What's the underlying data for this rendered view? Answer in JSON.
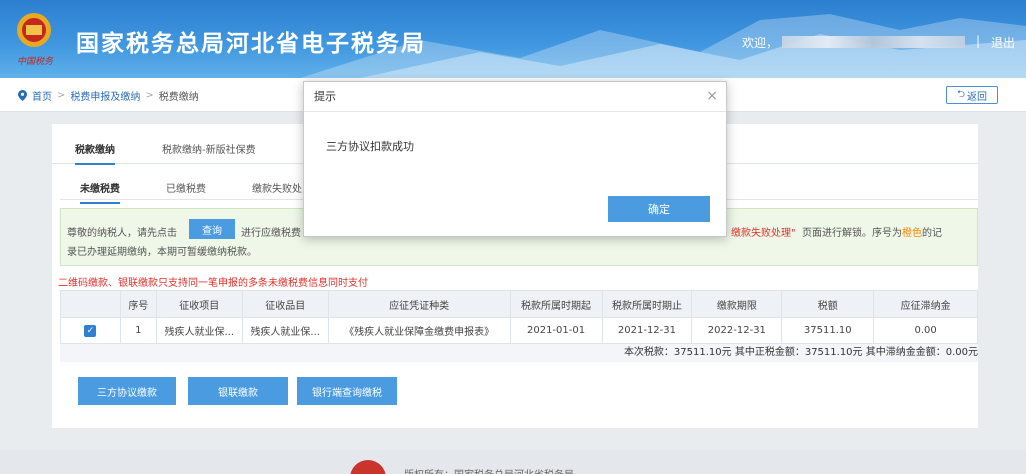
{
  "header": {
    "site_title": "国家税务总局河北省电子税务局",
    "welcome": "欢迎，",
    "separator": "|",
    "logout": "退出"
  },
  "breadcrumb": {
    "home": "首页",
    "level1": "税费申报及缴纳",
    "level2": "税费缴纳",
    "back": "返回"
  },
  "tabs_main": [
    {
      "label": "税款缴纳",
      "active": true
    },
    {
      "label": "税款缴纳-新版社保费",
      "active": false
    }
  ],
  "tabs_sub": [
    {
      "label": "未缴税费",
      "active": true
    },
    {
      "label": "已缴税费",
      "active": false
    },
    {
      "label": "缴款失败处",
      "active": false
    }
  ],
  "notice": {
    "line1_prefix": "尊敬的纳税人，请先点击",
    "query_button": "查询",
    "line1_mid": "进行应缴税费",
    "line1_right_red": "缴款失败处理\"",
    "line1_right_mid": "页面进行解锁。序号为",
    "line1_right_orange": "橙色",
    "line1_right_end": "的记",
    "line2": "录已办理延期缴纳，本期可暂缓缴纳税款。"
  },
  "warning": "二维码缴款、银联缴款只支持同一笔申报的多条未缴税费信息同时支付",
  "table": {
    "headers": [
      "",
      "序号",
      "征收项目",
      "征收品目",
      "应征凭证种类",
      "税款所属时期起",
      "税款所属时期止",
      "缴款期限",
      "税额",
      "应征滞纳金"
    ],
    "rows": [
      [
        "✓",
        "1",
        "残疾人就业保...",
        "残疾人就业保...",
        "《残疾人就业保障金缴费申报表》",
        "2021-01-01",
        "2021-12-31",
        "2022-12-31",
        "37511.10",
        "0.00"
      ]
    ]
  },
  "summary": "本次税款：37511.10元   其中正税金额：37511.10元   其中滞纳金金额：0.00元",
  "actions": {
    "tripartite": "三方协议缴款",
    "unionpay": "银联缴款",
    "bank": "银行端查询缴税"
  },
  "footer": {
    "text": "版权所有：国家税务总局河北省税务局"
  },
  "modal": {
    "title": "提示",
    "close": "×",
    "message": "三方协议扣款成功",
    "ok": "确定"
  }
}
